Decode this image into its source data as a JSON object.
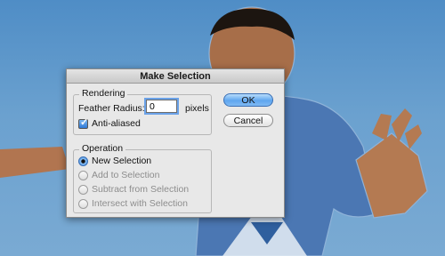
{
  "dialog": {
    "title": "Make Selection",
    "rendering": {
      "group_label": "Rendering",
      "feather_label": "Feather Radius:",
      "feather_value": "0",
      "pixels_label": "pixels",
      "anti_aliased_label": "Anti-aliased",
      "anti_aliased_checked": true
    },
    "operation": {
      "group_label": "Operation",
      "options": [
        {
          "label": "New Selection",
          "selected": true,
          "enabled": true
        },
        {
          "label": "Add to Selection",
          "selected": false,
          "enabled": false
        },
        {
          "label": "Subtract from Selection",
          "selected": false,
          "enabled": false
        },
        {
          "label": "Intersect with Selection",
          "selected": false,
          "enabled": false
        }
      ]
    },
    "buttons": {
      "ok_label": "OK",
      "cancel_label": "Cancel"
    }
  },
  "colors": {
    "sky": "#5b93c4",
    "shirt": "#4a78b4",
    "skin": "#b57a52",
    "accent": "#5fa6ef"
  }
}
